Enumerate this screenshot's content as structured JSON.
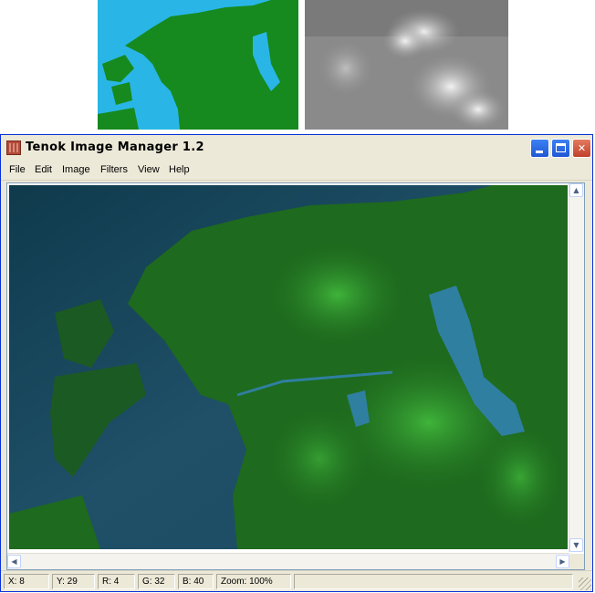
{
  "window": {
    "title": "Tenok Image Manager 1.2",
    "controls": {
      "minimize": "minimize",
      "maximize": "maximize",
      "close": "✕"
    }
  },
  "menu": [
    "File",
    "Edit",
    "Image",
    "Filters",
    "View",
    "Help"
  ],
  "status": {
    "x": "X: 8",
    "y": "Y: 29",
    "r": "R: 4",
    "g": "G: 32",
    "b": "B: 40",
    "zoom": "Zoom: 100%"
  },
  "scroll": {
    "up": "▲",
    "down": "▼",
    "left": "◀",
    "right": "▶"
  },
  "colors": {
    "sea_thumb": "#29b6e6",
    "land_thumb": "#168a1e",
    "sea_view": "#1d4a5e",
    "land_view": "#1e6a1e",
    "xp_blue": "#0831d9"
  }
}
